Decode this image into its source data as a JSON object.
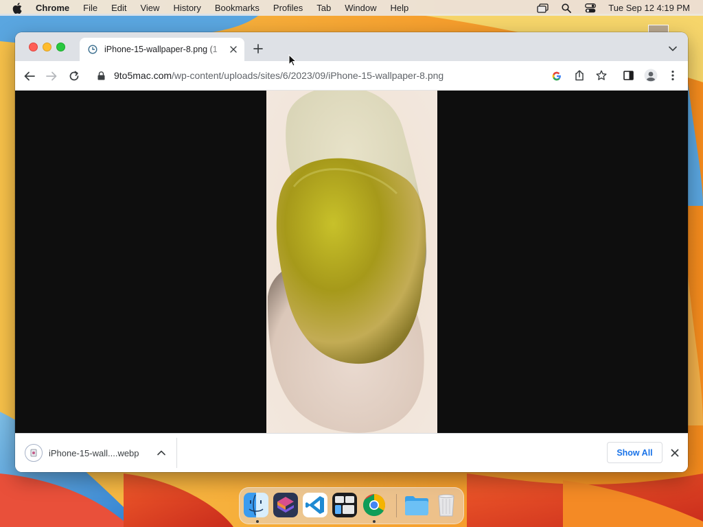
{
  "menubar": {
    "app_name": "Chrome",
    "items": [
      "File",
      "Edit",
      "View",
      "History",
      "Bookmarks",
      "Profiles",
      "Tab",
      "Window",
      "Help"
    ],
    "clock": "Tue Sep 12  4:19 PM",
    "icons": [
      "apple-logo-icon",
      "screen-mirroring-icon",
      "spotlight-search-icon",
      "control-center-icon"
    ]
  },
  "browser": {
    "tab": {
      "title": "iPhone-15-wallpaper-8.png (1",
      "favicon": "image-favicon-icon"
    },
    "toolbar": {
      "url_host": "9to5mac.com",
      "url_path": "/wp-content/uploads/sites/6/2023/09/iPhone-15-wallpaper-8.png",
      "icons": [
        "back-arrow-icon",
        "forward-arrow-icon",
        "reload-icon",
        "lock-icon",
        "google-lens-icon",
        "share-icon",
        "bookmark-star-icon",
        "side-panel-icon",
        "profile-avatar-icon",
        "more-menu-icon"
      ]
    },
    "download_bar": {
      "file_name": "iPhone-15-wall....webp",
      "show_all_label": "Show All"
    }
  },
  "dock": {
    "apps": [
      "Finder",
      "Affinity",
      "Visual Studio Code",
      "Mission Control",
      "Google Chrome",
      "Downloads Folder",
      "Trash"
    ]
  },
  "colors": {
    "tabstrip": "#dee1e6",
    "accent_blue": "#1a73e8",
    "viewport_bg": "#0e0e0e"
  }
}
